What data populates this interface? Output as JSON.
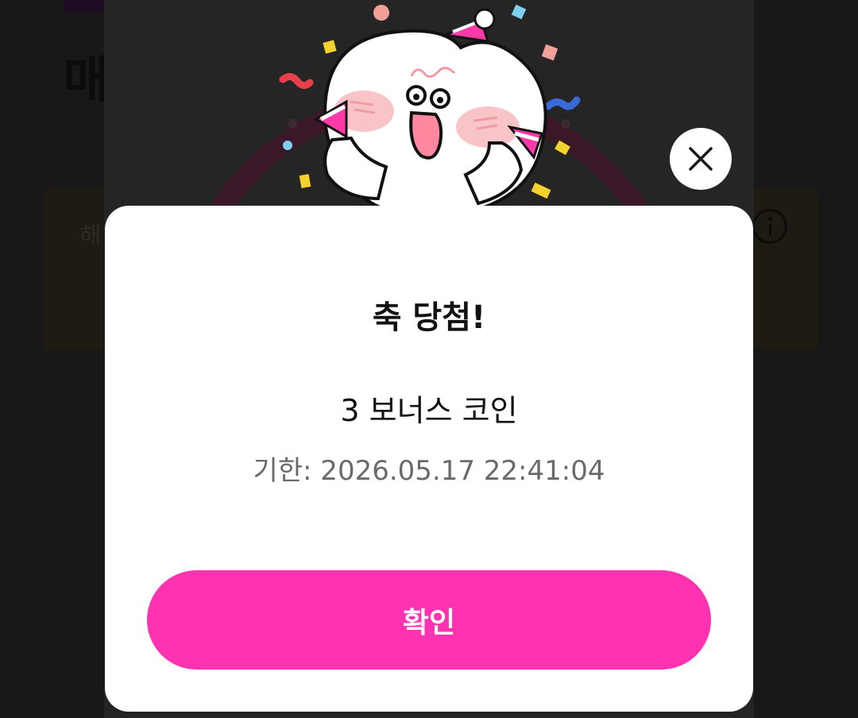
{
  "background": {
    "title_fragment": "매",
    "card_label_fragment": "해"
  },
  "modal": {
    "title": "축 당첨!",
    "reward": "3 보너스 코인",
    "expiry": "기한: 2026.05.17 22:41:04",
    "confirm_label": "확인"
  },
  "colors": {
    "accent": "#ff33b1",
    "overlay": "#181818",
    "card": "#ffffff",
    "expiry_text": "#6a6a6a"
  },
  "icons": {
    "close": "close-icon",
    "info": "info-icon",
    "mascot": "celebrating-mascot-illustration"
  }
}
